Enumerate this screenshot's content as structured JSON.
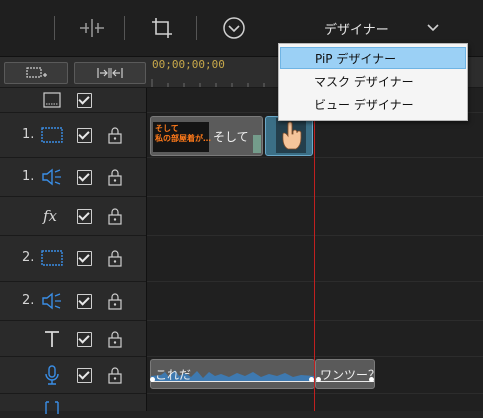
{
  "toolbar": {
    "designer_dropdown_label": "デザイナー"
  },
  "timeline": {
    "timecode": "00;00;00;00"
  },
  "designer_menu": {
    "items": [
      "PiP デザイナー",
      "マスク デザイナー",
      "ビュー デザイナー"
    ],
    "selected_index": 0
  },
  "tracks": [
    {
      "number": "",
      "type": "chapter",
      "icon": "chapter-track-icon",
      "has_lock": false
    },
    {
      "number": "1.",
      "type": "video",
      "icon": "video-track-icon",
      "has_lock": true
    },
    {
      "number": "1.",
      "type": "audio",
      "icon": "audio-track-icon",
      "has_lock": true
    },
    {
      "number": "",
      "type": "effect",
      "icon": "fx-track-icon",
      "has_lock": true
    },
    {
      "number": "2.",
      "type": "video",
      "icon": "video-track-icon",
      "has_lock": true
    },
    {
      "number": "2.",
      "type": "audio",
      "icon": "audio-track-icon",
      "has_lock": true
    },
    {
      "number": "",
      "type": "title",
      "icon": "title-track-icon",
      "has_lock": true
    },
    {
      "number": "",
      "type": "voice",
      "icon": "microphone-icon",
      "has_lock": true
    }
  ],
  "clips": {
    "video1_clip_thumb_text": "そして\n私の部屋着が…",
    "video1_clip_label": "そして",
    "voice_clip1_label": "これだ",
    "voice_clip2_label": "ワンツー？"
  },
  "colors": {
    "accent_blue": "#3a8ee6",
    "playhead": "#c02020",
    "timecode": "#c8a84a",
    "menu_highlight": "#9bd0f5"
  }
}
